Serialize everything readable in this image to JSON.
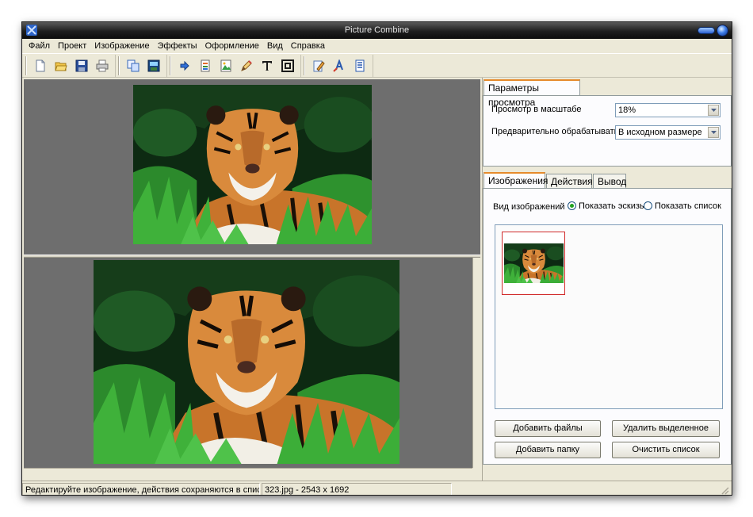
{
  "window": {
    "title": "Picture Combine"
  },
  "menu": [
    "Файл",
    "Проект",
    "Изображение",
    "Эффекты",
    "Оформление",
    "Вид",
    "Справка"
  ],
  "toolbar": {
    "icons": [
      "new-file-icon",
      "open-folder-icon",
      "save-icon",
      "print-icon",
      "copy-icon",
      "save-all-icon",
      "arrow-right-icon",
      "document-icon",
      "image-icon",
      "pencil-icon",
      "text-icon",
      "frame-icon",
      "edit-document-icon",
      "font-color-icon",
      "list-icon"
    ]
  },
  "preview_panel": {
    "tab_label": "Параметры просмотра",
    "scale_label": "Просмотр в масштабе",
    "scale_value": "18%",
    "preprocess_label": "Предварительно обрабатывать",
    "preprocess_value": "В исходном размере"
  },
  "images_panel": {
    "tabs": [
      "Изображения",
      "Действия",
      "Вывод"
    ],
    "view_label": "Вид изображений",
    "radio_thumbnails": "Показать эскизы",
    "radio_list": "Показать список",
    "view_mode": "thumbnails",
    "buttons": {
      "add_files": "Добавить файлы",
      "remove_selected": "Удалить выделенное",
      "add_folder": "Добавить папку",
      "clear_list": "Очистить список"
    }
  },
  "statusbar": {
    "hint": "Редактируйте изображение, действия сохраняются в списке",
    "file_info": "323.jpg - 2543 x 1692"
  },
  "colors": {
    "titlebar": "#1e1e1e",
    "window_bg": "#ece9d8",
    "preview_bg": "#6e6e6e",
    "selection": "#d12b2b",
    "tab_accent": "#e68b2c"
  }
}
